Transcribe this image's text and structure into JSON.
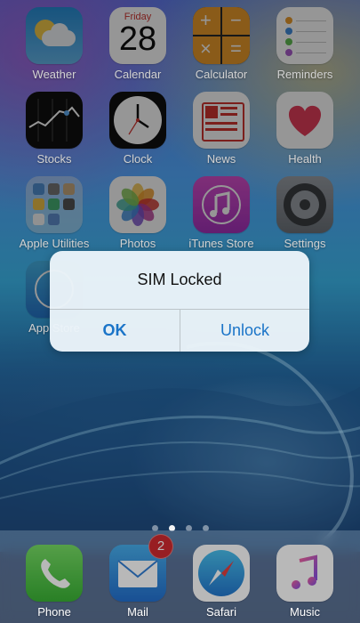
{
  "home": {
    "row1": [
      {
        "label": "Weather"
      },
      {
        "label": "Calendar",
        "weekday": "Friday",
        "day": "28"
      },
      {
        "label": "Calculator"
      },
      {
        "label": "Reminders"
      }
    ],
    "row2": [
      {
        "label": "Stocks"
      },
      {
        "label": "Clock"
      },
      {
        "label": "News"
      },
      {
        "label": "Health"
      }
    ],
    "row3": [
      {
        "label": "Apple Utilities"
      },
      {
        "label": "Photos"
      },
      {
        "label": "iTunes Store"
      },
      {
        "label": "Settings"
      }
    ],
    "row4": [
      {
        "label": "App Store"
      }
    ]
  },
  "alert": {
    "title": "SIM Locked",
    "ok_label": "OK",
    "unlock_label": "Unlock"
  },
  "pages": {
    "count": 4,
    "active_index": 1
  },
  "dock": [
    {
      "label": "Phone"
    },
    {
      "label": "Mail",
      "badge": "2"
    },
    {
      "label": "Safari"
    },
    {
      "label": "Music"
    }
  ],
  "colors": {
    "alert_button": "#1a74c8",
    "badge": "#e2262b"
  }
}
